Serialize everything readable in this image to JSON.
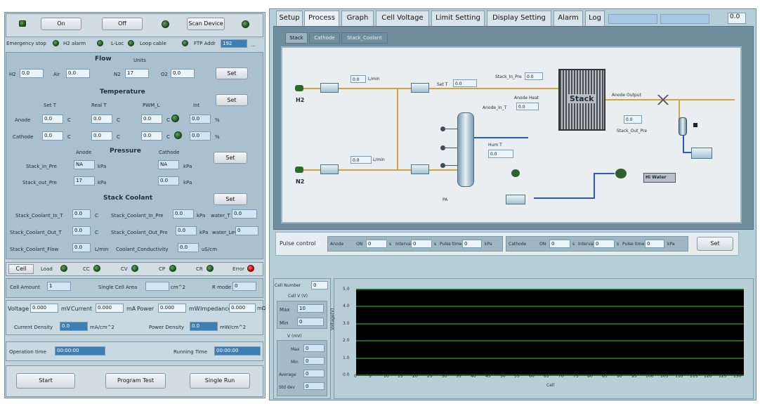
{
  "top_controls": {
    "on": "On",
    "off": "Off",
    "scan_device": "Scan Device"
  },
  "status_row": {
    "emergency_stop": "Emergency stop",
    "h2_alarm": "H2 alarm",
    "l_loc": "L-Loc",
    "load_cable": "Loop cable",
    "ftp_addr": "FTP Addr",
    "ftp_value": "192",
    "more": "..."
  },
  "flow": {
    "title": "Flow",
    "units": "Units",
    "fields": [
      {
        "label": "H2",
        "value": "0.0"
      },
      {
        "label": "Air",
        "value": "0.0"
      },
      {
        "label": "N2",
        "value": "17"
      },
      {
        "label": "O2",
        "value": "0.0"
      }
    ],
    "set": "Set"
  },
  "temperature": {
    "title": "Temperature",
    "cols": [
      "Set T",
      "Real T",
      "PWM_L",
      "Int"
    ],
    "anode_label": "Anode",
    "cathode_label": "Cathode",
    "anode": [
      "0.0",
      "0.0",
      "0.0",
      "0.0"
    ],
    "cathode": [
      "0.0",
      "0.0",
      "0.0",
      "0.0"
    ],
    "unit": "C",
    "pct": "%",
    "set": "Set"
  },
  "pressure": {
    "title": "Pressure",
    "anode_hdr": "Anode",
    "cathode_hdr": "Cathode",
    "stack_in_label": "Stack_in_Pre",
    "stack_in_anode": "NA",
    "stack_in_cathode": "NA",
    "stack_out_label": "Stack_out_Pre",
    "stack_out_anode": "17",
    "stack_out_cathode": "0.0",
    "unit": "kPa",
    "set": "Set"
  },
  "stack_coolant": {
    "title": "Stack Coolant",
    "set": "Set",
    "rows": [
      {
        "label": "Stack_Coolant_In_T",
        "value": "0.0",
        "unit": "C",
        "label2": "Stack_Coolant_In_Pre",
        "value2": "0.0",
        "unit2": "kPa",
        "label3": "water_T",
        "value3": "0.0"
      },
      {
        "label": "Stack_Coolant_Out_T",
        "value": "0.0",
        "unit": "C",
        "label2": "Stack_Coolant_Out_Pre",
        "value2": "0.0",
        "unit2": "kPa",
        "label3": "water_Lev",
        "value3": "0"
      },
      {
        "label": "Stack_Coolant_Flow",
        "value": "0.0",
        "unit": "L/min",
        "label2": "Coolant_Conductivity",
        "value2": "0.0",
        "unit2": "uS/cm"
      }
    ]
  },
  "load_tabs": [
    {
      "label": "Cell"
    },
    {
      "label": "Load"
    },
    {
      "label": "CC"
    },
    {
      "label": "CV"
    },
    {
      "label": "CP"
    },
    {
      "label": "CR"
    },
    {
      "label": "Error"
    }
  ],
  "cell": {
    "cell_amount_label": "Cell Amount",
    "cell_amount": "1",
    "single_area_label": "Single Cell Area",
    "single_area": "",
    "area_unit": "cm^2",
    "r_mode_label": "R mode",
    "r_mode": "0"
  },
  "readouts": {
    "voltage_label": "Voltage",
    "voltage": "0.000",
    "voltage_unit": "mV",
    "current_label": "Current",
    "current": "0.000",
    "current_unit": "mA",
    "power_label": "Power",
    "power": "0.000",
    "power_unit": "mW",
    "impedance_label": "Impedance",
    "impedance": "0.000",
    "impedance_unit": "mΩ",
    "current_density_label": "Current Density",
    "current_density": "0.0",
    "cd_unit": "mA/cm^2",
    "power_density_label": "Power Density",
    "power_density": "0.0",
    "pd_unit": "mW/cm^2"
  },
  "times": {
    "operation_label": "Operation time",
    "operation": "00:00:00",
    "running_label": "Running Time",
    "running": "00:00:00"
  },
  "bottom_buttons": {
    "start": "Start",
    "program_test": "Program Test",
    "single_run": "Single Run"
  },
  "tabs": [
    {
      "label": "Setup"
    },
    {
      "label": "Process"
    },
    {
      "label": "Graph"
    },
    {
      "label": "Cell Voltage"
    },
    {
      "label": "Limit Setting"
    },
    {
      "label": "Display Setting"
    },
    {
      "label": "Alarm"
    },
    {
      "label": "Log"
    }
  ],
  "tab_right_value": "0.0",
  "inner_tabs": [
    {
      "label": "Stack"
    },
    {
      "label": "Cathode"
    },
    {
      "label": "Stack_Coolant"
    }
  ],
  "process": {
    "h2": "H2",
    "n2": "N2",
    "flow_h2": "0.0",
    "flow_unit": "L/min",
    "flow_n2": "0.0",
    "set_t_label": "Set T",
    "set_t": "0.0",
    "stack_in_pre_label": "Stack_In_Pre",
    "stack_in_pre": "0.0",
    "anode_heat_label": "Anode Heat",
    "anode_in_label": "Anode_In_T",
    "anode_in": "0.0",
    "stack": "Stack",
    "anode_output": "Anode Output",
    "stack_out_pre_label": "Stack_Out_Pre",
    "stack_out_pre": "0.0",
    "humi_label": "Hum T",
    "humi": "0.0",
    "hi_water": "Hi Water",
    "pa": "PA"
  },
  "pulse": {
    "title": "Pulse control",
    "anode": "Anode",
    "cathode": "Cathode",
    "on_label": "ON",
    "on": "0",
    "interval_label": "Interval",
    "interval": "0",
    "pulse_label": "Pulse time",
    "pulse": "0",
    "unit": "s",
    "kpa": "kPa",
    "set": "Set"
  },
  "side": {
    "cell_number_label": "Cell Number",
    "cell_number": "0",
    "cell_v_label": "Cell V (V)",
    "max_label": "Max",
    "max": "10",
    "min_label": "Min",
    "min": "0",
    "v_label": "V (mV)",
    "max2": "0",
    "min2": "0",
    "avg_label": "Average",
    "avg": "0",
    "std_label": "Std dev",
    "std": "0"
  },
  "chart": {
    "ylabel": "Voltage(V)",
    "yticks": [
      "5.0",
      "4.0",
      "3.0",
      "2.0",
      "1.0",
      "0.0"
    ],
    "xticks": [
      "0",
      "5",
      "10",
      "15",
      "20",
      "25",
      "30",
      "35",
      "40",
      "45",
      "50",
      "55",
      "60",
      "65",
      "70",
      "75",
      "80",
      "85",
      "90",
      "95",
      "100",
      "105",
      "110",
      "115",
      "120",
      "125",
      "130"
    ],
    "xlabel": "Cell",
    "grid_color": "#3cc84a",
    "bg": "#000000"
  }
}
